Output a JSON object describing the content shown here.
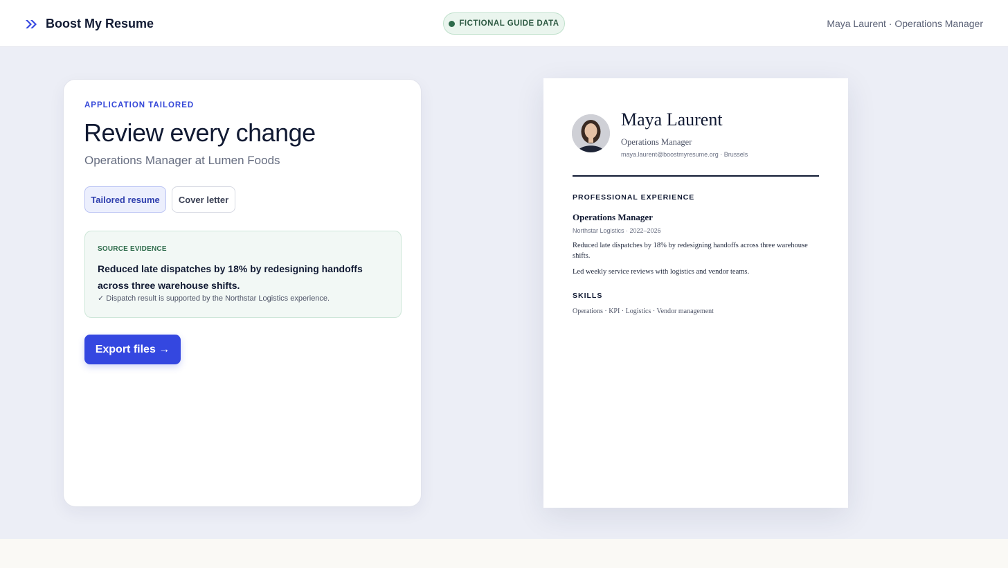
{
  "header": {
    "brand_name": "Boost My Resume",
    "brand_icon": "double-chevron-right-icon",
    "badge_label": "FICTIONAL GUIDE DATA",
    "user_info": "Maya Laurent · Operations Manager"
  },
  "review_panel": {
    "eyebrow": "APPLICATION TAILORED",
    "title": "Review every change",
    "subtitle": "Operations Manager at Lumen Foods",
    "tabs": [
      {
        "label": "Tailored resume",
        "active": true
      },
      {
        "label": "Cover letter",
        "active": false
      }
    ],
    "evidence": {
      "label": "SOURCE EVIDENCE",
      "text": "Reduced late dispatches by 18% by redesigning handoffs across three warehouse shifts.",
      "note": "✓ Dispatch result is supported by the Northstar Logistics experience."
    },
    "export_label": "Export files →"
  },
  "resume": {
    "name": "Maya Laurent",
    "title": "Operations Manager",
    "contact": "maya.laurent@boostmyresume.org · Brussels",
    "experience_heading": "PROFESSIONAL EXPERIENCE",
    "job": {
      "title": "Operations Manager",
      "meta": "Northstar Logistics · 2022–2026",
      "bullets": [
        "Reduced late dispatches by 18% by redesigning handoffs across three warehouse shifts.",
        "Led weekly service reviews with logistics and vendor teams."
      ]
    },
    "skills_heading": "SKILLS",
    "skills": "Operations · KPI · Logistics · Vendor management"
  },
  "colors": {
    "accent": "#3447e0",
    "badge_green": "#2e6b4b",
    "page_bg": "#eceef6"
  }
}
